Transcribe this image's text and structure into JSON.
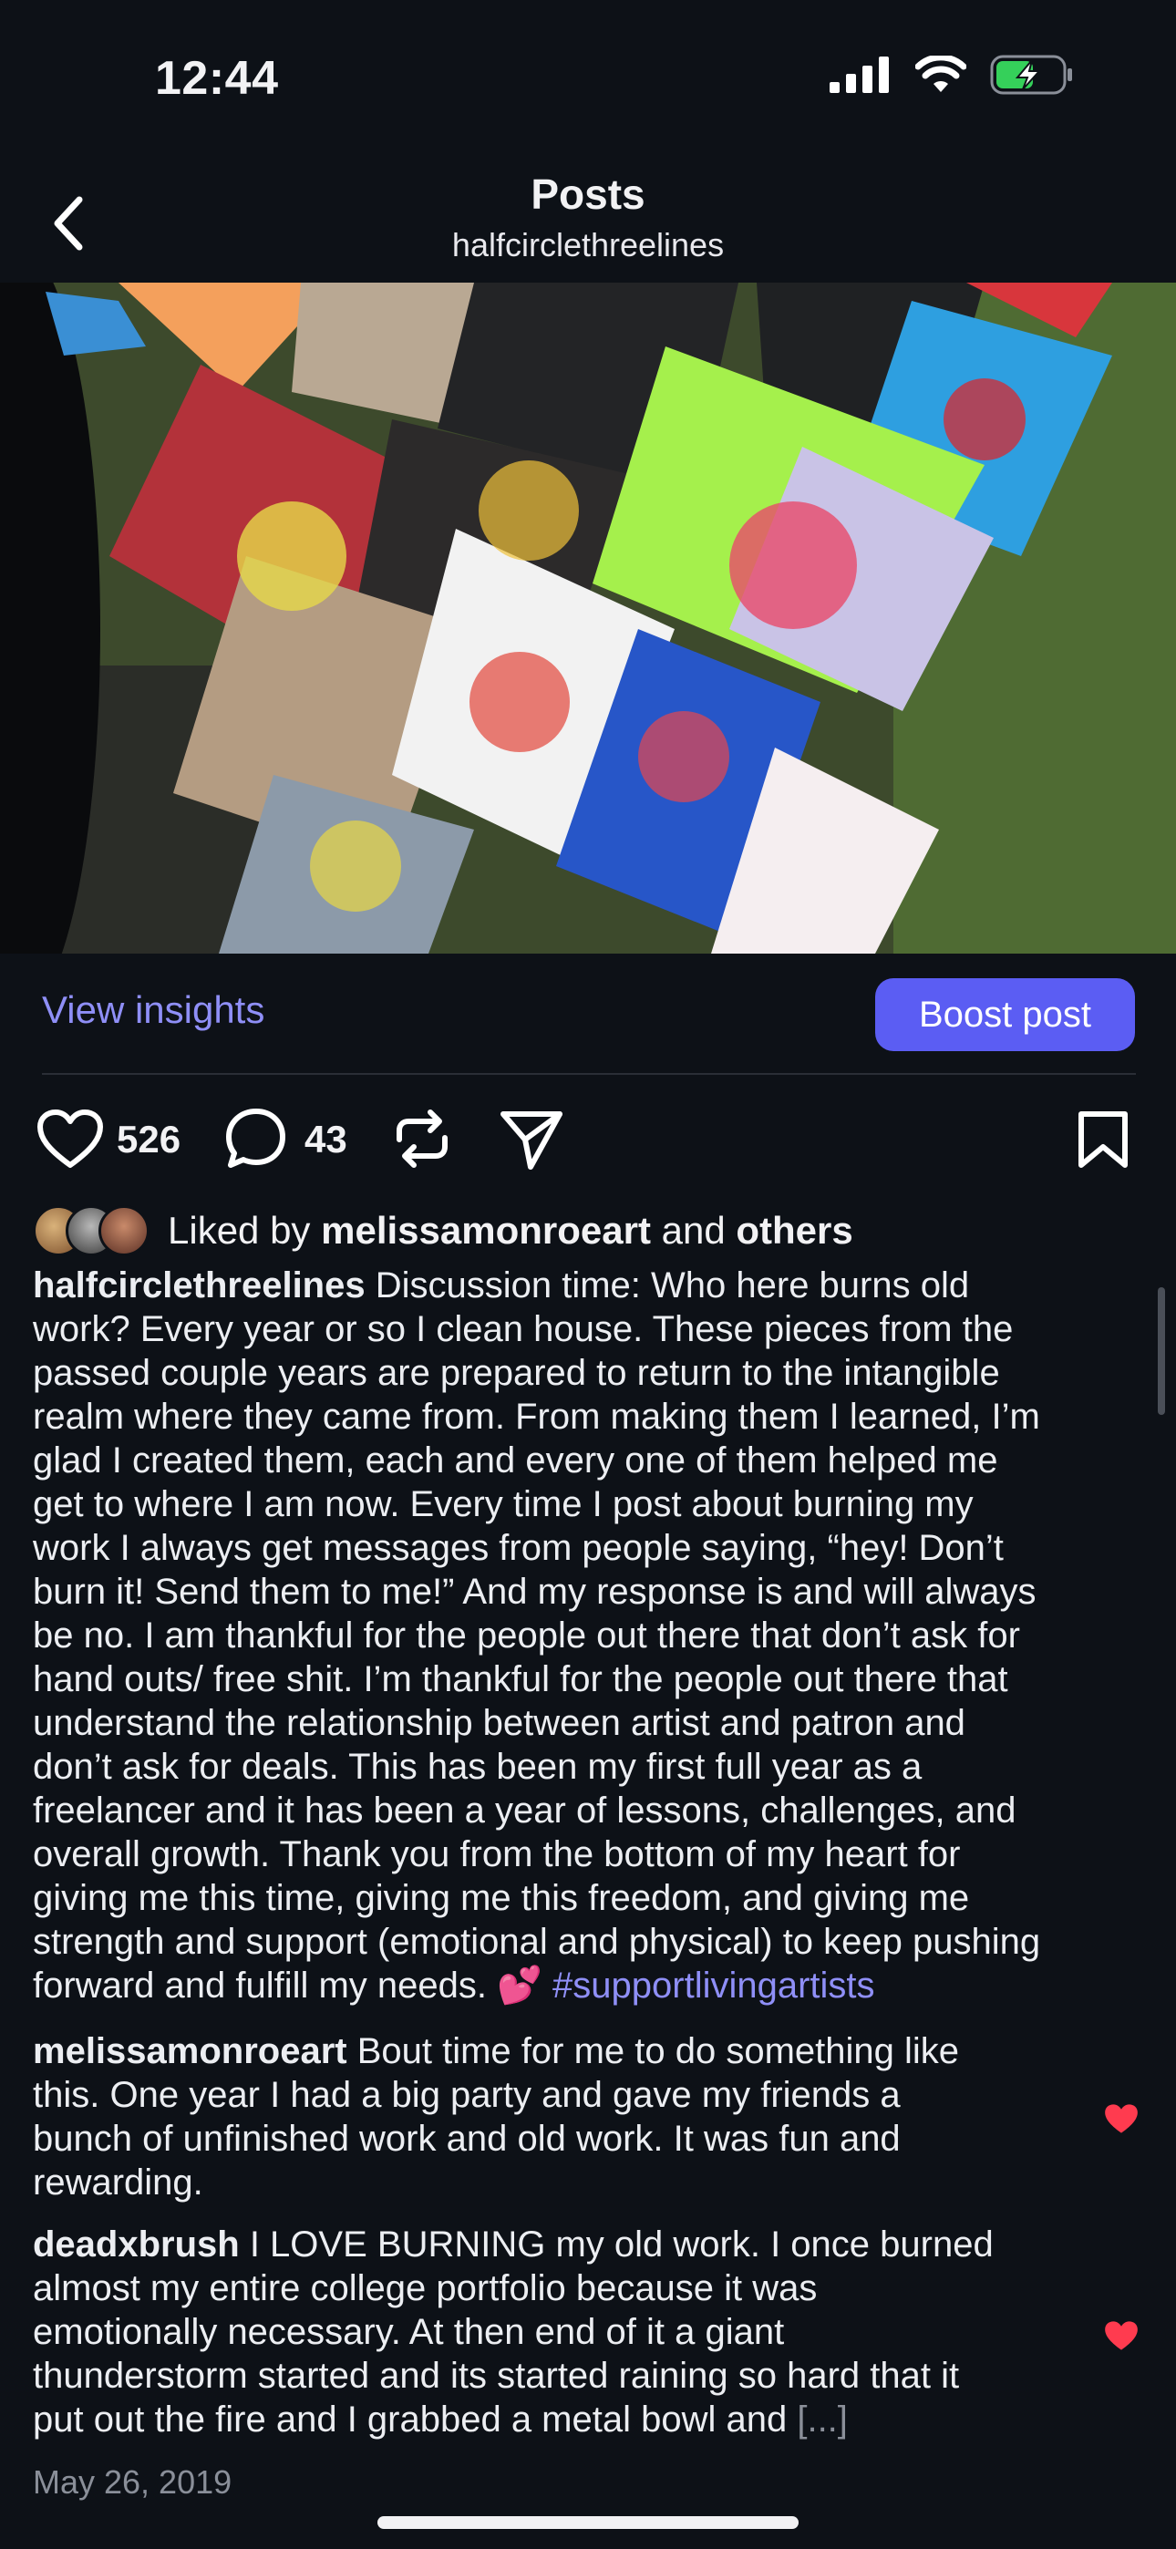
{
  "status_bar": {
    "time": "12:44"
  },
  "header": {
    "title": "Posts",
    "subtitle": "halfcirclethreelines"
  },
  "post_image": {
    "alt_icon": "artwork-photo"
  },
  "insights": {
    "view_label": "View insights",
    "boost_label": "Boost post"
  },
  "actions": {
    "likes": "526",
    "comments": "43"
  },
  "liked_by": {
    "prefix": "Liked by ",
    "user": "melissamonroeart",
    "middle": " and ",
    "others": "others"
  },
  "caption": {
    "username": "halfcirclethreelines",
    "text": " Discussion time: Who here burns old\nwork? Every year or so I clean house. These pieces from the\npassed couple years are prepared to return to the intangible\nrealm where they came from. From making them I learned, I’m\nglad I created them, each and every one of them helped me\nget to where I am now. Every time I post about burning my\nwork I always get messages from people saying, “hey! Don’t\nburn it! Send them to me!” And my response is and will always\nbe no. I am thankful for the people out there that don’t ask for\nhand outs/ free shit. I’m thankful for the people out there that\nunderstand the relationship between artist and patron and\ndon’t ask for deals. This has been my first full year as a\nfreelancer and it has been a year of lessons, challenges, and\noverall growth. Thank you from the bottom of my heart for\ngiving me this time, giving me this freedom, and giving me\nstrength and support (emotional and physical) to keep pushing\nforward and fulfill my needs. 💕 ",
    "hashtag": "#supportlivingartists"
  },
  "comments": [
    {
      "username": "melissamonroeart",
      "text": " Bout time for me to do something like\nthis. One year I had a big party and gave my friends a\nbunch of unfinished work and old work. It was fun and\nrewarding."
    },
    {
      "username": "deadxbrush",
      "text": " I LOVE BURNING my old work. I once burned\nalmost my entire college portfolio because it was\nemotionally necessary. At then end of it a giant\nthunderstorm started and its started raining so hard that it\nput out the fire and I grabbed a metal bowl and ",
      "more": "[...]"
    }
  ],
  "date": "May 26, 2019",
  "colors": {
    "accent": "#5b5df3",
    "link": "#8f8ff7",
    "heart": "#ff3b4f",
    "background": "#0d1117"
  }
}
